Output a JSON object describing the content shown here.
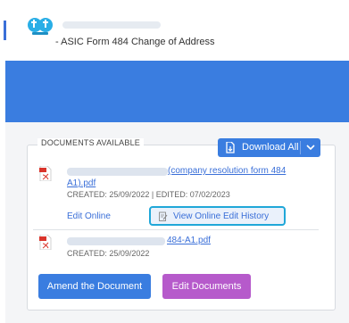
{
  "header": {
    "subtitle": "- ASIC Form 484 Change of Address"
  },
  "documents": {
    "legend": "DOCUMENTS AVAILABLE",
    "download_all_label": "Download All",
    "files": [
      {
        "name_line1": "(company resolution form 484",
        "name_line2": "A1).pdf",
        "meta": "CREATED: 25/09/2022 | EDITED: 07/02/2023",
        "edit_online_label": "Edit Online",
        "history_label": "View Online Edit History"
      },
      {
        "name_line1": "484-A1.pdf",
        "meta": "CREATED: 25/09/2022"
      }
    ]
  },
  "actions": {
    "amend_label": "Amend the Document",
    "edit_label": "Edit Documents"
  },
  "colors": {
    "primary": "#3a7de0",
    "purple": "#b65acb",
    "highlight": "#20a7d8",
    "pdf_red": "#d9342b"
  }
}
